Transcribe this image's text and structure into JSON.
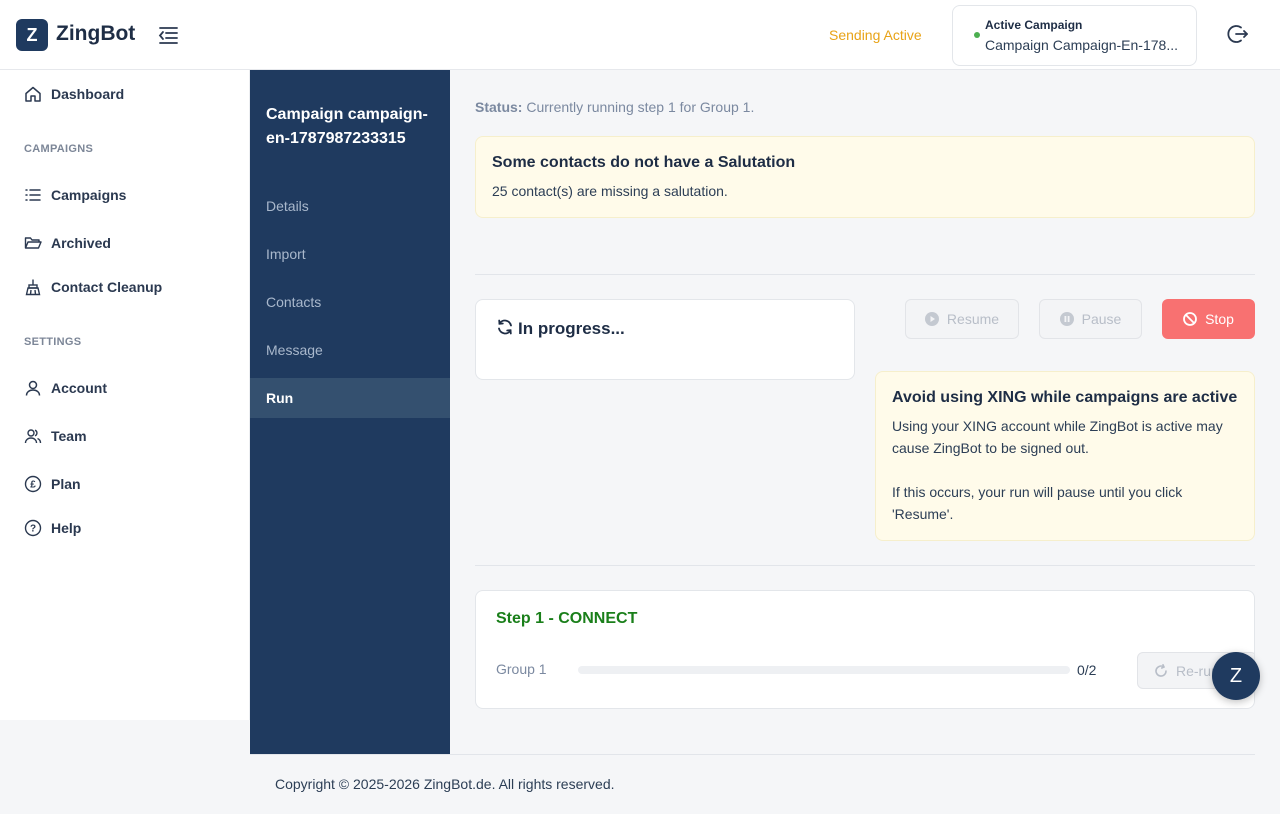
{
  "brand": {
    "logo_letter": "Z",
    "name": "ZingBot"
  },
  "header": {
    "sending_status": "Sending Active",
    "active_campaign_label": "Active Campaign",
    "active_campaign_name": "Campaign Campaign-En-178...",
    "colors": {
      "sending": "#e8a317",
      "active_dot": "#4caf50"
    }
  },
  "sidebar": {
    "dashboard": "Dashboard",
    "campaigns_section": "CAMPAIGNS",
    "campaigns": "Campaigns",
    "archived": "Archived",
    "contact_cleanup": "Contact Cleanup",
    "settings_section": "SETTINGS",
    "account": "Account",
    "team": "Team",
    "plan": "Plan",
    "help": "Help"
  },
  "campaign_nav": {
    "title": "Campaign campaign-en-1787987233315",
    "items": [
      "Details",
      "Import",
      "Contacts",
      "Message",
      "Run"
    ],
    "active": "Run"
  },
  "main": {
    "status_label": "Status:",
    "status_text": "Currently running step 1 for Group 1.",
    "salutation_warning": {
      "title": "Some contacts do not have a Salutation",
      "text": "25 contact(s) are missing a salutation."
    },
    "progress_title": "In progress...",
    "buttons": {
      "resume": "Resume",
      "pause": "Pause",
      "stop": "Stop"
    },
    "xing_warning": {
      "title": "Avoid using XING while campaigns are active",
      "line1": "Using your XING account while ZingBot is active may cause ZingBot to be signed out.",
      "line2": "If this occurs, your run will pause until you click 'Resume'."
    },
    "step": {
      "title": "Step 1 - CONNECT",
      "group_label": "Group 1",
      "progress_fraction": 0,
      "count": "0/2",
      "rerun": "Re-run"
    }
  },
  "footer": {
    "copyright": "Copyright © 2025-2026 ZingBot.de. All rights reserved."
  },
  "chat": {
    "letter": "Z"
  }
}
